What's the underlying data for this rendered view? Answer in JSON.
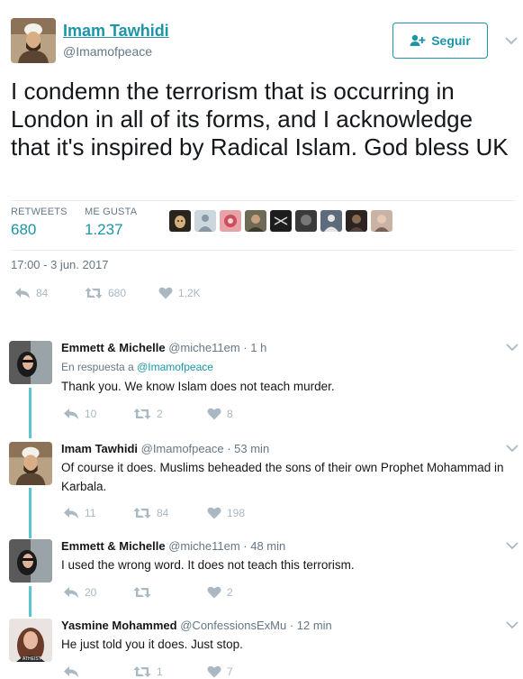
{
  "main": {
    "name": "Imam Tawhidi",
    "handle": "@Imamofpeace",
    "follow_label": "Seguir",
    "text": "I condemn the terrorism that is occurring in London in all of its forms, and I acknowledge that it's inspired by Radical Islam. God bless UK",
    "stats": {
      "retweets_label": "RETWEETS",
      "retweets_value": "680",
      "likes_label": "ME GUSTA",
      "likes_value": "1.237"
    },
    "timestamp": "17:00 - 3 jun. 2017",
    "actions": {
      "replies": "84",
      "retweets": "680",
      "likes": "1,2K"
    }
  },
  "replies": [
    {
      "name": "Emmett & Michelle",
      "handle": "@miche11em",
      "time": "· 1 h",
      "in_reply_prefix": "En respuesta a",
      "in_reply_handle": "@Imamofpeace",
      "text": "Thank you. We know Islam does not teach murder.",
      "actions": {
        "replies": "10",
        "retweets": "2",
        "likes": "8"
      }
    },
    {
      "name": "Imam Tawhidi",
      "handle": "@Imamofpeace",
      "time": "· 53 min",
      "text": "Of course it does. Muslims beheaded the sons of their own Prophet Mohammad in Karbala.",
      "actions": {
        "replies": "11",
        "retweets": "84",
        "likes": "198"
      }
    },
    {
      "name": "Emmett & Michelle",
      "handle": "@miche11em",
      "time": "· 48 min",
      "text": "I used the wrong word. It does not teach this terrorism.",
      "actions": {
        "replies": "20",
        "retweets": "",
        "likes": "2"
      }
    },
    {
      "name": "Yasmine Mohammed",
      "handle": "@ConfessionsExMu",
      "time": "· 12 min",
      "text": "He just told you it does. Just stop.",
      "actions": {
        "replies": "",
        "retweets": "1",
        "likes": "7"
      }
    }
  ],
  "icons": [
    "add-user-icon",
    "chevron-down-icon",
    "reply-icon",
    "retweet-icon",
    "heart-icon"
  ],
  "colors": {
    "accent": "#1b95a7",
    "muted": "#aab8c2",
    "text": "#14171a",
    "secondary": "#657786",
    "thread": "#5bc6cf"
  }
}
